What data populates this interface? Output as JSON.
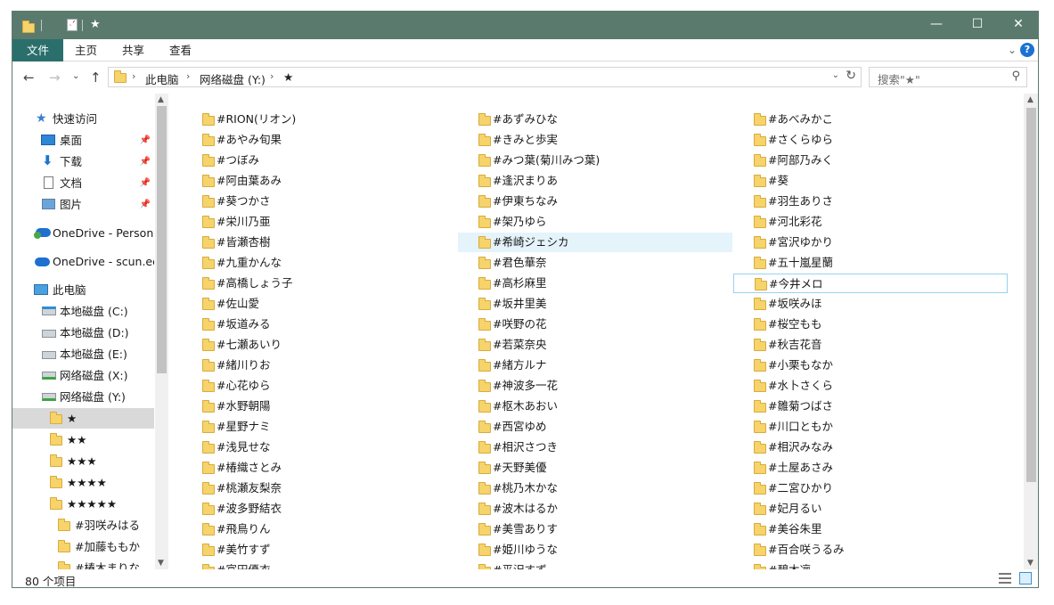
{
  "window": {
    "title": "★",
    "controls": {
      "minimize": "—",
      "maximize": "☐",
      "close": "✕"
    }
  },
  "ribbon": {
    "tabs": [
      "文件",
      "主页",
      "共享",
      "查看"
    ],
    "collapse_icon": "chevron-down-icon",
    "help_label": "?"
  },
  "address": {
    "crumbs": [
      "此电脑",
      "网络磁盘 (Y:)",
      "★"
    ],
    "separator": "›"
  },
  "search": {
    "placeholder": "搜索\"★\""
  },
  "nav": {
    "quick_access": "快速访问",
    "pinned": [
      "桌面",
      "下载",
      "文档",
      "图片"
    ],
    "onedrive1": "OneDrive - Persona",
    "onedrive2": "OneDrive - scun.edu",
    "this_pc": "此电脑",
    "drives": [
      "本地磁盘 (C:)",
      "本地磁盘 (D:)",
      "本地磁盘 (E:)",
      "网络磁盘 (X:)",
      "网络磁盘 (Y:)"
    ],
    "folders": [
      "★",
      "★★",
      "★★★",
      "★★★★",
      "★★★★★"
    ],
    "subfolders": [
      "#羽咲みはる",
      "#加藤ももか",
      "#椿木まりな"
    ]
  },
  "columns": [
    [
      "#RION(リオン)",
      "#あやみ旬果",
      "#つぼみ",
      "#阿由葉あみ",
      "#葵つかさ",
      "#栄川乃亜",
      "#皆瀬杏樹",
      "#九重かんな",
      "#高橋しょう子",
      "#佐山愛",
      "#坂道みる",
      "#七瀬あいり",
      "#緒川りお",
      "#心花ゆら",
      "#水野朝陽",
      "#星野ナミ",
      "#浅見せな",
      "#椿織さとみ",
      "#桃瀬友梨奈",
      "#波多野結衣",
      "#飛鳥りん",
      "#美竹すず",
      "#富田優衣"
    ],
    [
      "#あずみひな",
      "#きみと歩実",
      "#みつ葉(菊川みつ葉)",
      "#逢沢まりあ",
      "#伊東ちなみ",
      "#架乃ゆら",
      "#希崎ジェシカ",
      "#君色華奈",
      "#高杉麻里",
      "#坂井里美",
      "#咲野の花",
      "#若菜奈央",
      "#緒方ルナ",
      "#神波多一花",
      "#枢木あおい",
      "#西宮ゆめ",
      "#相沢さつき",
      "#天野美優",
      "#桃乃木かな",
      "#波木はるか",
      "#美雪ありす",
      "#姫川ゆうな",
      "#平沢すず"
    ],
    [
      "#あべみかこ",
      "#さくらゆら",
      "#阿部乃みく",
      "#葵",
      "#羽生ありさ",
      "#河北彩花",
      "#宮沢ゆかり",
      "#五十嵐星蘭",
      "#今井メロ",
      "#坂咲みほ",
      "#桜空もも",
      "#秋吉花音",
      "#小栗もなか",
      "#水卜さくら",
      "#雛菊つばさ",
      "#川口ともか",
      "#相沢みなみ",
      "#土屋あさみ",
      "#二宮ひかり",
      "#妃月るい",
      "#美谷朱里",
      "#百合咲うるみ",
      "#碧木凛"
    ]
  ],
  "status": {
    "count": "80 个项目"
  },
  "colors": {
    "titlebar": "#5a7a6e",
    "file_tab": "#2a6f6c",
    "folder": "#f6d36b",
    "hover": "#e5f3fb"
  }
}
